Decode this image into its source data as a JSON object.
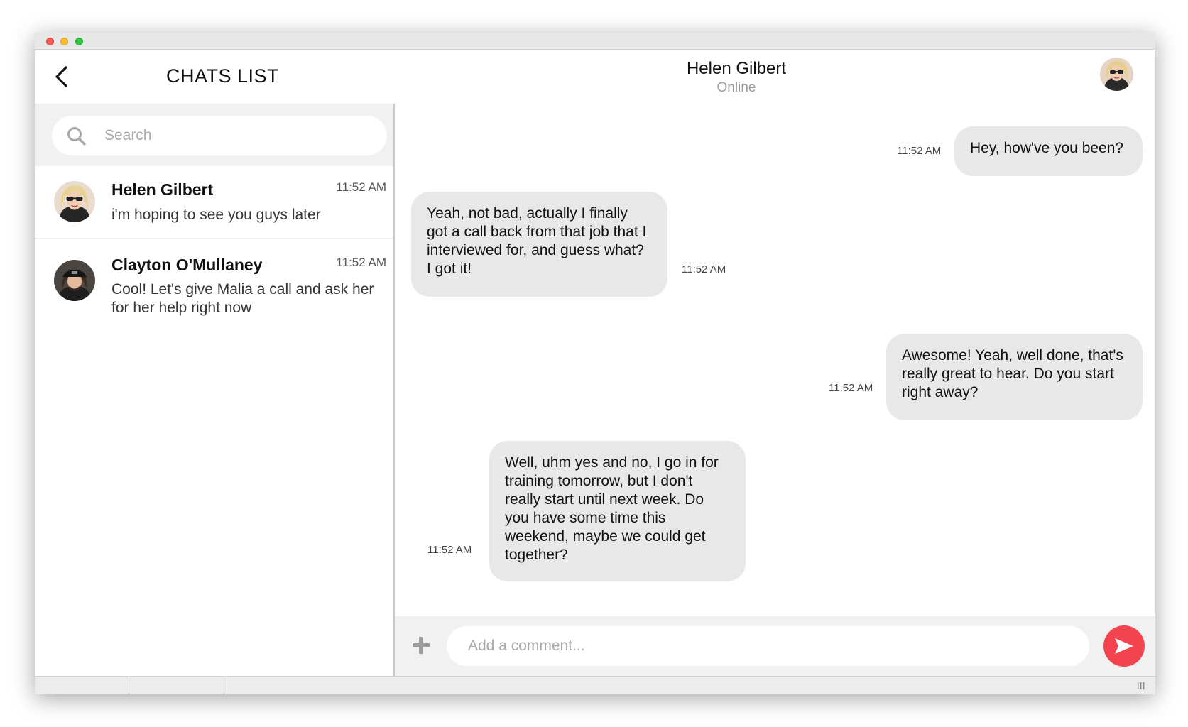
{
  "header": {
    "title": "CHATS LIST",
    "contact_name": "Helen Gilbert",
    "contact_status": "Online"
  },
  "search": {
    "placeholder": "Search"
  },
  "chats": [
    {
      "name": "Helen Gilbert",
      "time": "11:52 AM",
      "preview": "i'm hoping to see you guys later"
    },
    {
      "name": "Clayton O'Mullaney",
      "time": "11:52 AM",
      "preview": "Cool! Let's give Malia a call and ask her for her help right now"
    }
  ],
  "messages": [
    {
      "direction": "outgoing",
      "text": "Hey, how've you been?",
      "time": "11:52 AM"
    },
    {
      "direction": "incoming",
      "text": "Yeah, not bad, actually I finally got a call back from that job that I interviewed for, and guess what? I got it!",
      "time": "11:52 AM"
    },
    {
      "direction": "outgoing",
      "text": "Awesome! Yeah, well done, that's really great to hear. Do you start right away?",
      "time": "11:52 AM"
    },
    {
      "direction": "incoming",
      "text": "Well, uhm yes and no, I go in for training tomorrow, but I don't really start until next week. Do you have some time this weekend, maybe we could get together?",
      "time": "11:52 AM"
    }
  ],
  "composer": {
    "placeholder": "Add a comment..."
  },
  "colors": {
    "accent": "#f2434f",
    "bubble": "#e8e8e8",
    "panel": "#f1f1f1"
  },
  "icons": {
    "back": "chevron-left-icon",
    "search": "search-icon",
    "add": "plus-icon",
    "send": "send-icon"
  }
}
